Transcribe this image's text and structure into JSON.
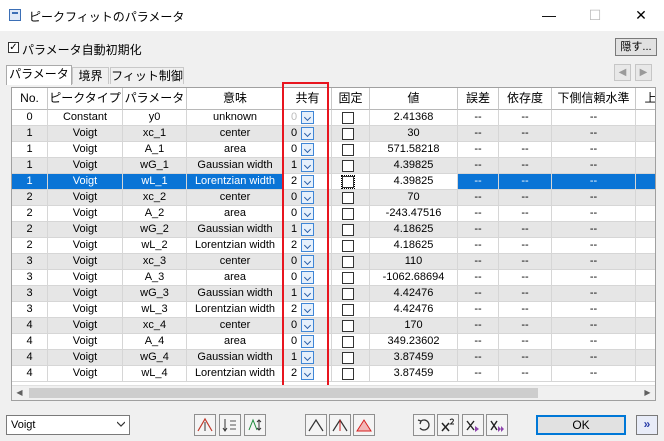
{
  "window": {
    "title": "ピークフィットのパラメータ",
    "minimize": "—",
    "maximize": "☐",
    "close": "✕"
  },
  "auto_init": {
    "label": "パラメータ自動初期化",
    "checked": true,
    "mark": "✓"
  },
  "hide_button": "隠す...",
  "tabs": [
    {
      "label": "パラメータ",
      "active": true
    },
    {
      "label": "境界",
      "active": false
    },
    {
      "label": "フィット制御",
      "active": false
    }
  ],
  "nav": {
    "prev": "◀",
    "next": "▶"
  },
  "columns": [
    "No.",
    "ピークタイプ",
    "パラメータ",
    "意味",
    "共有",
    "固定",
    "値",
    "誤差",
    "依存度",
    "下側信頼水準",
    "上"
  ],
  "rows": [
    {
      "no": "0",
      "type": "Constant",
      "param": "y0",
      "meaning": "unknown",
      "share": "0",
      "value": "2.41368",
      "err": "--",
      "dep": "--",
      "lcl": "--",
      "up": ""
    },
    {
      "no": "1",
      "type": "Voigt",
      "param": "xc_1",
      "meaning": "center",
      "share": "0",
      "value": "30",
      "err": "--",
      "dep": "--",
      "lcl": "--",
      "up": ""
    },
    {
      "no": "1",
      "type": "Voigt",
      "param": "A_1",
      "meaning": "area",
      "share": "0",
      "value": "571.58218",
      "err": "--",
      "dep": "--",
      "lcl": "--",
      "up": ""
    },
    {
      "no": "1",
      "type": "Voigt",
      "param": "wG_1",
      "meaning": "Gaussian width",
      "share": "1",
      "value": "4.39825",
      "err": "--",
      "dep": "--",
      "lcl": "--",
      "up": ""
    },
    {
      "no": "1",
      "type": "Voigt",
      "param": "wL_1",
      "meaning": "Lorentzian width",
      "share": "2",
      "value": "4.39825",
      "err": "--",
      "dep": "--",
      "lcl": "--",
      "up": ""
    },
    {
      "no": "2",
      "type": "Voigt",
      "param": "xc_2",
      "meaning": "center",
      "share": "0",
      "value": "70",
      "err": "--",
      "dep": "--",
      "lcl": "--",
      "up": ""
    },
    {
      "no": "2",
      "type": "Voigt",
      "param": "A_2",
      "meaning": "area",
      "share": "0",
      "value": "-243.47516",
      "err": "--",
      "dep": "--",
      "lcl": "--",
      "up": ""
    },
    {
      "no": "2",
      "type": "Voigt",
      "param": "wG_2",
      "meaning": "Gaussian width",
      "share": "1",
      "value": "4.18625",
      "err": "--",
      "dep": "--",
      "lcl": "--",
      "up": ""
    },
    {
      "no": "2",
      "type": "Voigt",
      "param": "wL_2",
      "meaning": "Lorentzian width",
      "share": "2",
      "value": "4.18625",
      "err": "--",
      "dep": "--",
      "lcl": "--",
      "up": ""
    },
    {
      "no": "3",
      "type": "Voigt",
      "param": "xc_3",
      "meaning": "center",
      "share": "0",
      "value": "110",
      "err": "--",
      "dep": "--",
      "lcl": "--",
      "up": ""
    },
    {
      "no": "3",
      "type": "Voigt",
      "param": "A_3",
      "meaning": "area",
      "share": "0",
      "value": "-1062.68694",
      "err": "--",
      "dep": "--",
      "lcl": "--",
      "up": ""
    },
    {
      "no": "3",
      "type": "Voigt",
      "param": "wG_3",
      "meaning": "Gaussian width",
      "share": "1",
      "value": "4.42476",
      "err": "--",
      "dep": "--",
      "lcl": "--",
      "up": ""
    },
    {
      "no": "3",
      "type": "Voigt",
      "param": "wL_3",
      "meaning": "Lorentzian width",
      "share": "2",
      "value": "4.42476",
      "err": "--",
      "dep": "--",
      "lcl": "--",
      "up": ""
    },
    {
      "no": "4",
      "type": "Voigt",
      "param": "xc_4",
      "meaning": "center",
      "share": "0",
      "value": "170",
      "err": "--",
      "dep": "--",
      "lcl": "--",
      "up": ""
    },
    {
      "no": "4",
      "type": "Voigt",
      "param": "A_4",
      "meaning": "area",
      "share": "0",
      "value": "349.23602",
      "err": "--",
      "dep": "--",
      "lcl": "--",
      "up": ""
    },
    {
      "no": "4",
      "type": "Voigt",
      "param": "wG_4",
      "meaning": "Gaussian width",
      "share": "1",
      "value": "3.87459",
      "err": "--",
      "dep": "--",
      "lcl": "--",
      "up": ""
    },
    {
      "no": "4",
      "type": "Voigt",
      "param": "wL_4",
      "meaning": "Lorentzian width",
      "share": "2",
      "value": "3.87459",
      "err": "--",
      "dep": "--",
      "lcl": "--",
      "up": ""
    }
  ],
  "selected_row": 4,
  "scrollbar": {
    "left": "◀",
    "right": "▶"
  },
  "bottom": {
    "peak_type": "Voigt",
    "tools": [
      "add-peak-icon",
      "sort-icon",
      "reorder-icon",
      "peak-shape-icon",
      "peak-marker-icon",
      "peak-fill-icon",
      "undo-icon",
      "chi-square-icon",
      "fit-iteration-icon",
      "fit-until-converged-icon"
    ],
    "ok": "OK",
    "expand": "»"
  },
  "colors": {
    "selection": "#0a74d6",
    "highlight": "#e8151f",
    "row_alt": "#e6e6e6",
    "accent": "#0078d7"
  }
}
